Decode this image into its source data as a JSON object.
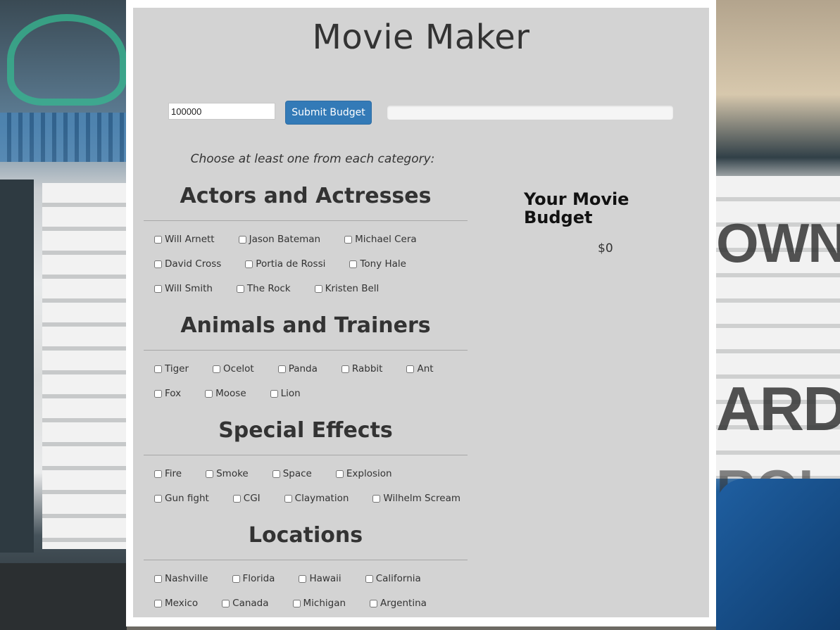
{
  "app": {
    "title": "Movie Maker"
  },
  "budget": {
    "input_value": "100000",
    "submit_label": "Submit Budget",
    "progress_percent": 0
  },
  "instruction": "Choose at least one from each category:",
  "categories": [
    {
      "title": "Actors and Actresses",
      "rows": [
        [
          "Will Arnett",
          "Jason Bateman",
          "Michael Cera"
        ],
        [
          "David Cross",
          "Portia de Rossi",
          "Tony Hale"
        ],
        [
          "Will Smith",
          "The Rock",
          "Kristen Bell"
        ]
      ]
    },
    {
      "title": "Animals and Trainers",
      "rows": [
        [
          "Tiger",
          "Ocelot",
          "Panda",
          "Rabbit",
          "Ant"
        ],
        [
          "Fox",
          "Moose",
          "Lion"
        ]
      ]
    },
    {
      "title": "Special Effects",
      "rows": [
        [
          "Fire",
          "Smoke",
          "Space",
          "Explosion"
        ],
        [
          "Gun fight",
          "CGI",
          "Claymation",
          "Wilhelm Scream"
        ]
      ]
    },
    {
      "title": "Locations",
      "rows": [
        [
          "Nashville",
          "Florida",
          "Hawaii",
          "California"
        ],
        [
          "Mexico",
          "Canada",
          "Michigan",
          "Argentina"
        ]
      ]
    }
  ],
  "sidebar": {
    "title": "Your Movie Budget",
    "amount": "$0"
  },
  "colors": {
    "panel": "#d3d3d3",
    "button": "#337ab7",
    "text": "#333333"
  }
}
